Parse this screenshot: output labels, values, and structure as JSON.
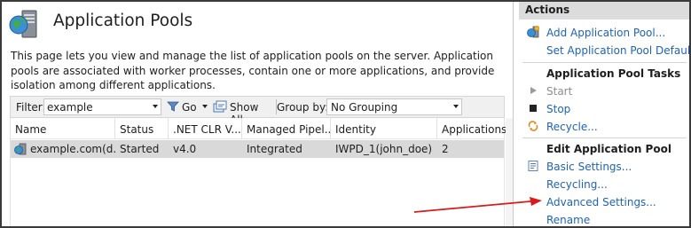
{
  "header": {
    "title": "Application Pools",
    "description": "This page lets you view and manage the list of application pools on the server. Application pools are associated with worker processes, contain one or more applications, and provide isolation among different applications."
  },
  "filter_bar": {
    "filter_label": "Filter:",
    "filter_value": "example",
    "go_label": "Go",
    "show_all_label": "Show All",
    "group_by_label": "Group by:",
    "group_by_value": "No Grouping"
  },
  "grid": {
    "columns": [
      "Name",
      "Status",
      ".NET CLR V...",
      "Managed Pipel...",
      "Identity",
      "Applications"
    ],
    "rows": [
      {
        "name": "example.com(d...",
        "status": "Started",
        "clr": "v4.0",
        "pipeline": "Integrated",
        "identity": "IWPD_1(john_doe)",
        "applications": "2"
      }
    ]
  },
  "actions": {
    "title": "Actions",
    "top": [
      {
        "label": "Add Application Pool...",
        "icon": "add-pool-icon"
      },
      {
        "label": "Set Application Pool Defaults...",
        "icon": ""
      }
    ],
    "tasks_heading": "Application Pool Tasks",
    "tasks": [
      {
        "label": "Start",
        "icon": "play-icon",
        "disabled": true
      },
      {
        "label": "Stop",
        "icon": "stop-icon",
        "disabled": false
      },
      {
        "label": "Recycle...",
        "icon": "recycle-icon",
        "disabled": false
      }
    ],
    "edit_heading": "Edit Application Pool",
    "edit": [
      {
        "label": "Basic Settings...",
        "icon": "settings-icon"
      },
      {
        "label": "Recycling...",
        "icon": ""
      },
      {
        "label": "Advanced Settings...",
        "icon": ""
      },
      {
        "label": "Rename",
        "icon": ""
      }
    ]
  },
  "colors": {
    "link": "#1f63b5",
    "selected_row": "#d9d9d9",
    "actions_header": "#dcdcdc",
    "annotation_arrow": "#d81b1b"
  }
}
